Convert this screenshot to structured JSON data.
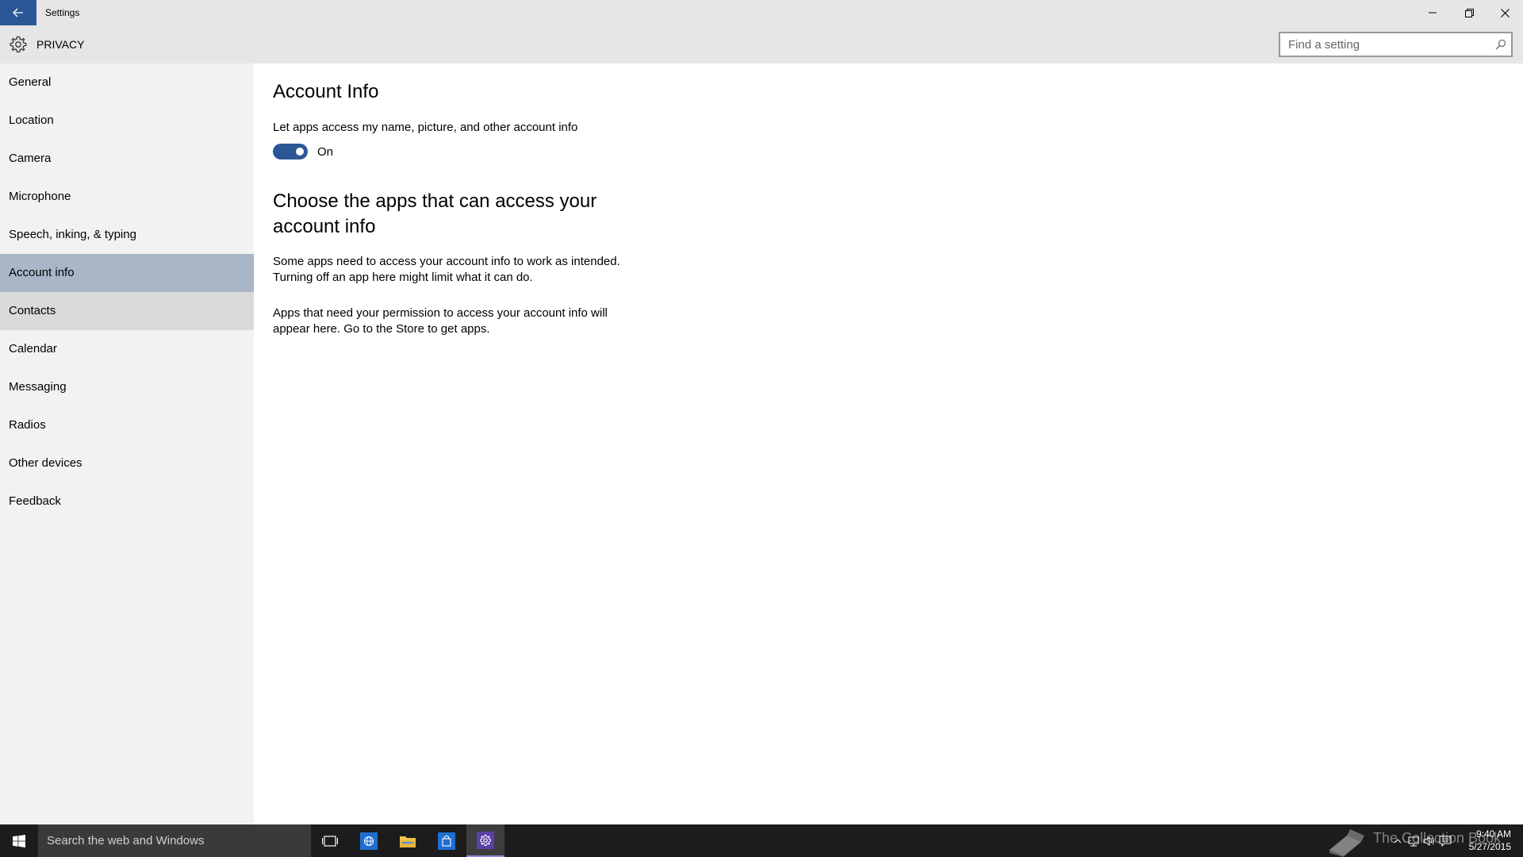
{
  "window": {
    "title": "Settings",
    "minimize_glyph": "—",
    "close_glyph": "✕"
  },
  "header": {
    "title": "PRIVACY",
    "icon": "gear-icon"
  },
  "search": {
    "placeholder": "Find a setting",
    "value": ""
  },
  "sidebar": {
    "items": [
      {
        "label": "General"
      },
      {
        "label": "Location"
      },
      {
        "label": "Camera"
      },
      {
        "label": "Microphone"
      },
      {
        "label": "Speech, inking, & typing"
      },
      {
        "label": "Account info",
        "selected": true
      },
      {
        "label": "Contacts",
        "hover": true
      },
      {
        "label": "Calendar"
      },
      {
        "label": "Messaging"
      },
      {
        "label": "Radios"
      },
      {
        "label": "Other devices"
      },
      {
        "label": "Feedback"
      }
    ]
  },
  "main": {
    "title": "Account Info",
    "toggle": {
      "description": "Let apps access my name, picture, and other account info",
      "state_label": "On",
      "on": true
    },
    "subheading": "Choose the apps that can access your account info",
    "paragraph1": "Some apps need to access your account info to work as intended. Turning off an app here might limit what it can do.",
    "paragraph2": "Apps that need your permission to access your account info will appear here. Go to the Store to get apps."
  },
  "taskbar": {
    "search_placeholder": "Search the web and Windows",
    "watermark": "The Collection Book",
    "clock_time": "9:40 AM",
    "clock_date": "5/27/2015",
    "accent_color": "#2b5797"
  }
}
